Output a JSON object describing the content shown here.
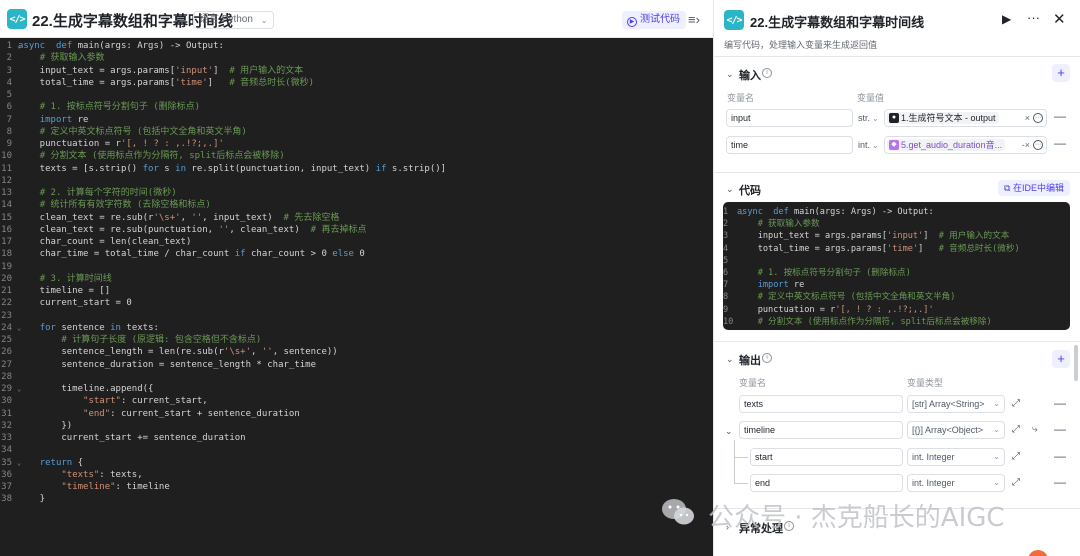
{
  "editor": {
    "title": "22.生成字幕数组和字幕时间线",
    "language_select": "语言 Python",
    "test_button": "测试代码",
    "lines": [
      {
        "n": "1",
        "fold": true,
        "segs": [
          [
            "kw",
            "async"
          ],
          [
            "",
            "  "
          ],
          [
            "kw",
            "def"
          ],
          [
            "",
            " main(args: Args) -> Output:"
          ]
        ]
      },
      {
        "n": "2",
        "segs": [
          [
            "",
            "    "
          ],
          [
            "cm",
            "# 获取输入参数"
          ]
        ]
      },
      {
        "n": "3",
        "segs": [
          [
            "",
            "    input_text = args.params["
          ],
          [
            "str",
            "'input'"
          ],
          [
            "",
            "]  "
          ],
          [
            "cm",
            "# 用户输入的文本"
          ]
        ]
      },
      {
        "n": "4",
        "segs": [
          [
            "",
            "    total_time = args.params["
          ],
          [
            "str",
            "'time'"
          ],
          [
            "",
            "]   "
          ],
          [
            "cm",
            "# 音频总时长(微秒)"
          ]
        ]
      },
      {
        "n": "5",
        "segs": [
          [
            "",
            ""
          ]
        ]
      },
      {
        "n": "6",
        "segs": [
          [
            "",
            "    "
          ],
          [
            "cm",
            "# 1. 按标点符号分割句子 (删除标点)"
          ]
        ]
      },
      {
        "n": "7",
        "segs": [
          [
            "",
            "    "
          ],
          [
            "kw",
            "import"
          ],
          [
            "",
            " re"
          ]
        ]
      },
      {
        "n": "8",
        "segs": [
          [
            "",
            "    "
          ],
          [
            "cm",
            "# 定义中英文标点符号 (包括中文全角和英文半角)"
          ]
        ]
      },
      {
        "n": "9",
        "segs": [
          [
            "",
            "    punctuation = r"
          ],
          [
            "str",
            "'[, ! ? : ,.!?;,.]'"
          ]
        ]
      },
      {
        "n": "10",
        "segs": [
          [
            "",
            "    "
          ],
          [
            "cm",
            "# 分割文本 (使用标点作为分隔符, split后标点会被移除)"
          ]
        ]
      },
      {
        "n": "11",
        "segs": [
          [
            "",
            "    texts = [s.strip() "
          ],
          [
            "kw",
            "for"
          ],
          [
            "",
            " s "
          ],
          [
            "kw",
            "in"
          ],
          [
            "",
            " re.split(punctuation, input_text) "
          ],
          [
            "kw",
            "if"
          ],
          [
            "",
            " s.strip()]"
          ]
        ]
      },
      {
        "n": "12",
        "segs": [
          [
            "",
            ""
          ]
        ]
      },
      {
        "n": "13",
        "segs": [
          [
            "",
            "    "
          ],
          [
            "cm",
            "# 2. 计算每个字符的时间(微秒)"
          ]
        ]
      },
      {
        "n": "14",
        "segs": [
          [
            "",
            "    "
          ],
          [
            "cm",
            "# 统计所有有效字符数 (去除空格和标点)"
          ]
        ]
      },
      {
        "n": "15",
        "segs": [
          [
            "",
            "    clean_text = re.sub(r"
          ],
          [
            "str",
            "'\\s+'"
          ],
          [
            "",
            ", "
          ],
          [
            "str",
            "''"
          ],
          [
            "",
            ", input_text)  "
          ],
          [
            "cm",
            "# 先去除空格"
          ]
        ]
      },
      {
        "n": "16",
        "segs": [
          [
            "",
            "    clean_text = re.sub(punctuation, "
          ],
          [
            "str",
            "''"
          ],
          [
            "",
            ", clean_text)  "
          ],
          [
            "cm",
            "# 再去掉标点"
          ]
        ]
      },
      {
        "n": "17",
        "segs": [
          [
            "",
            "    char_count = len(clean_text)"
          ]
        ]
      },
      {
        "n": "18",
        "segs": [
          [
            "",
            "    char_time = total_time / char_count "
          ],
          [
            "kw",
            "if"
          ],
          [
            "",
            " char_count > 0 "
          ],
          [
            "kw",
            "else"
          ],
          [
            "",
            " 0"
          ]
        ]
      },
      {
        "n": "19",
        "segs": [
          [
            "",
            ""
          ]
        ]
      },
      {
        "n": "20",
        "segs": [
          [
            "",
            "    "
          ],
          [
            "cm",
            "# 3. 计算时间线"
          ]
        ]
      },
      {
        "n": "21",
        "segs": [
          [
            "",
            "    timeline = []"
          ]
        ]
      },
      {
        "n": "22",
        "segs": [
          [
            "",
            "    current_start = 0"
          ]
        ]
      },
      {
        "n": "23",
        "segs": [
          [
            "",
            ""
          ]
        ]
      },
      {
        "n": "24",
        "fold": true,
        "segs": [
          [
            "",
            "    "
          ],
          [
            "kw",
            "for"
          ],
          [
            "",
            " sentence "
          ],
          [
            "kw",
            "in"
          ],
          [
            "",
            " texts:"
          ]
        ]
      },
      {
        "n": "25",
        "segs": [
          [
            "",
            "        "
          ],
          [
            "cm",
            "# 计算句子长度 (原逻辑: 包含空格但不含标点)"
          ]
        ]
      },
      {
        "n": "26",
        "segs": [
          [
            "",
            "        sentence_length = len(re.sub(r"
          ],
          [
            "str",
            "'\\s+'"
          ],
          [
            "",
            ", "
          ],
          [
            "str",
            "''"
          ],
          [
            "",
            ", sentence))"
          ]
        ]
      },
      {
        "n": "27",
        "segs": [
          [
            "",
            "        sentence_duration = sentence_length * char_time"
          ]
        ]
      },
      {
        "n": "28",
        "segs": [
          [
            "",
            ""
          ]
        ]
      },
      {
        "n": "29",
        "fold": true,
        "segs": [
          [
            "",
            "        timeline.append({"
          ]
        ]
      },
      {
        "n": "30",
        "segs": [
          [
            "",
            "            "
          ],
          [
            "str",
            "\"start\""
          ],
          [
            "",
            ": current_start,"
          ]
        ]
      },
      {
        "n": "31",
        "segs": [
          [
            "",
            "            "
          ],
          [
            "str",
            "\"end\""
          ],
          [
            "",
            ": current_start + sentence_duration"
          ]
        ]
      },
      {
        "n": "32",
        "segs": [
          [
            "",
            "        })"
          ]
        ]
      },
      {
        "n": "33",
        "segs": [
          [
            "",
            "        current_start += sentence_duration"
          ]
        ]
      },
      {
        "n": "34",
        "segs": [
          [
            "",
            ""
          ]
        ]
      },
      {
        "n": "35",
        "fold": true,
        "segs": [
          [
            "",
            "    "
          ],
          [
            "kw",
            "return"
          ],
          [
            "",
            " {"
          ]
        ]
      },
      {
        "n": "36",
        "segs": [
          [
            "",
            "        "
          ],
          [
            "str",
            "\"texts\""
          ],
          [
            "",
            ": texts,"
          ]
        ]
      },
      {
        "n": "37",
        "segs": [
          [
            "",
            "        "
          ],
          [
            "str",
            "\"timeline\""
          ],
          [
            "",
            ": timeline"
          ]
        ]
      },
      {
        "n": "38",
        "segs": [
          [
            "",
            "    }"
          ]
        ]
      }
    ]
  },
  "panel": {
    "title": "22.生成字幕数组和字幕时间线",
    "description": "编写代码，处理输入变量来生成返回值",
    "input": {
      "section_title": "输入",
      "col_name": "变量名",
      "col_value": "变量值",
      "rows": [
        {
          "name": "input",
          "type": "str.",
          "ref": "1.生成符号文本 - output",
          "ref_icon": "bot"
        },
        {
          "name": "time",
          "type": "int.",
          "ref": "5.get_audio_duration音...",
          "ref_icon": "plugin"
        }
      ]
    },
    "code": {
      "section_title": "代码",
      "ide_button": "在IDE中编辑",
      "preview_lines": 10
    },
    "output": {
      "section_title": "输出",
      "col_name": "变量名",
      "col_type": "变量类型",
      "rows": [
        {
          "name": "texts",
          "type": "Array<String>",
          "type_icon": "[str]"
        },
        {
          "name": "timeline",
          "type": "Array<Object>",
          "type_icon": "[{}]"
        }
      ],
      "children": [
        {
          "name": "start",
          "type": "int. Integer"
        },
        {
          "name": "end",
          "type": "int. Integer"
        }
      ]
    },
    "exception": {
      "section_title": "异常处理"
    }
  },
  "watermark": "公众号 · 杰克船长的AIGC",
  "colors": {
    "accent": "#4e40e5",
    "logo": "#2bb6c8",
    "editor_bg": "#1f1f1f",
    "keyword": "#569cd6",
    "string": "#ce9178",
    "comment": "#6a9955"
  }
}
